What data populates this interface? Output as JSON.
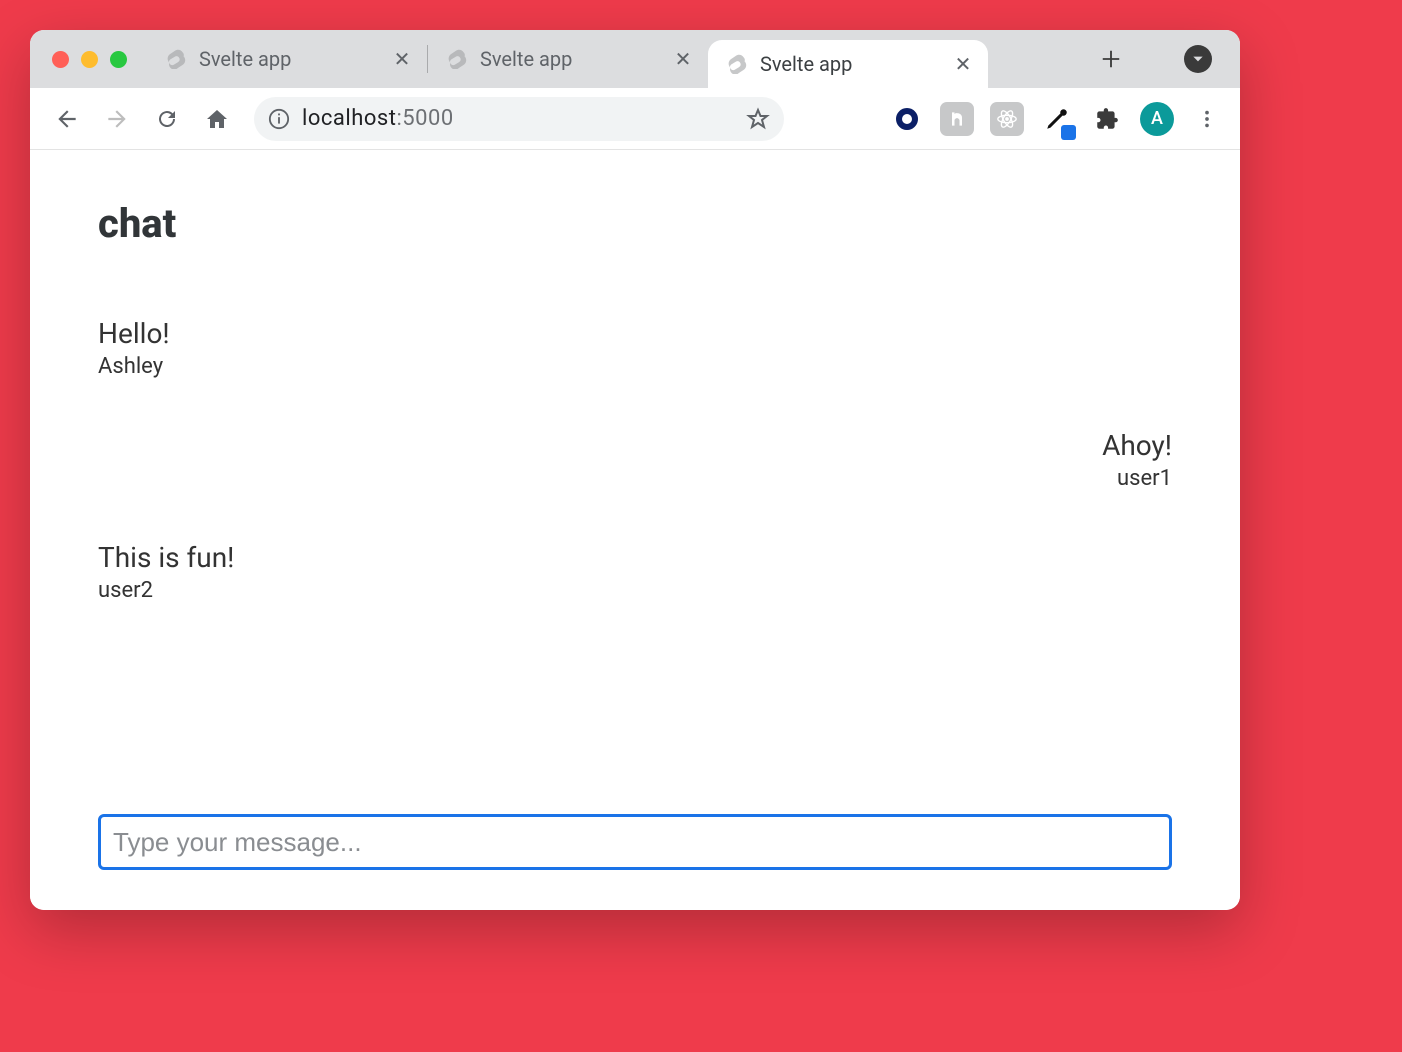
{
  "browser": {
    "tabs": [
      {
        "title": "Svelte app",
        "active": false
      },
      {
        "title": "Svelte app",
        "active": false
      },
      {
        "title": "Svelte app",
        "active": true
      }
    ],
    "address": {
      "host": "localhost",
      "port": ":5000"
    },
    "avatar_letter": "A"
  },
  "page": {
    "title": "chat",
    "messages": [
      {
        "text": "Hello!",
        "user": "Ashley",
        "align": "left"
      },
      {
        "text": "Ahoy!",
        "user": "user1",
        "align": "right"
      },
      {
        "text": "This is fun!",
        "user": "user2",
        "align": "left"
      }
    ],
    "composer_placeholder": "Type your message..."
  }
}
